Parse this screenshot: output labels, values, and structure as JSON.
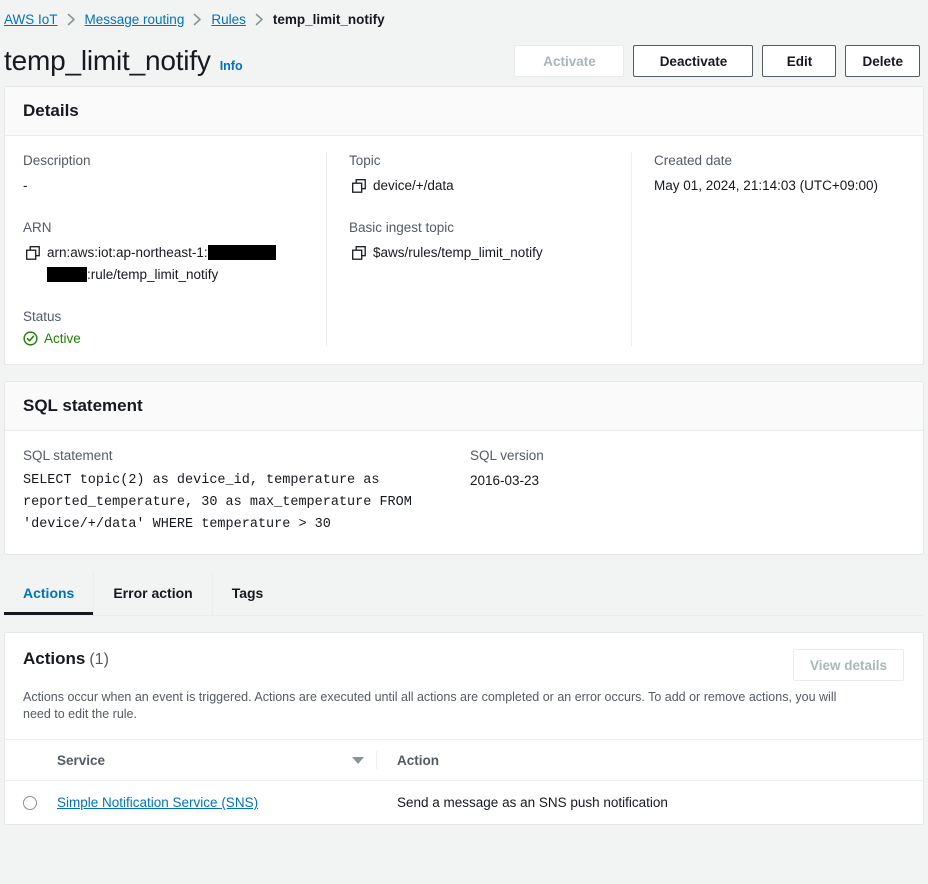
{
  "breadcrumb": {
    "items": [
      {
        "label": "AWS IoT",
        "current": false
      },
      {
        "label": "Message routing",
        "current": false
      },
      {
        "label": "Rules",
        "current": false
      },
      {
        "label": "temp_limit_notify",
        "current": true
      }
    ]
  },
  "header": {
    "title": "temp_limit_notify",
    "info_label": "Info",
    "buttons": [
      {
        "label": "Activate",
        "disabled": true
      },
      {
        "label": "Deactivate",
        "disabled": false
      },
      {
        "label": "Edit",
        "disabled": false
      },
      {
        "label": "Delete",
        "disabled": false
      }
    ]
  },
  "details": {
    "panel_title": "Details",
    "description_label": "Description",
    "description_value": "-",
    "arn_label": "ARN",
    "arn_prefix": "arn:aws:iot:ap-northeast-1:",
    "arn_suffix": ":rule/temp_limit_notify",
    "status_label": "Status",
    "status_value": "Active",
    "status_color": "#1d8102",
    "topic_label": "Topic",
    "topic_value": "device/+/data",
    "basic_ingest_label": "Basic ingest topic",
    "basic_ingest_value": "$aws/rules/temp_limit_notify",
    "created_label": "Created date",
    "created_value": "May 01, 2024, 21:14:03 (UTC+09:00)"
  },
  "sql": {
    "panel_title": "SQL statement",
    "statement_label": "SQL statement",
    "statement_value": "SELECT topic(2) as device_id, temperature as reported_temperature, 30 as max_temperature FROM 'device/+/data' WHERE temperature > 30",
    "version_label": "SQL version",
    "version_value": "2016-03-23"
  },
  "tabs": [
    {
      "label": "Actions",
      "active": true
    },
    {
      "label": "Error action",
      "active": false
    },
    {
      "label": "Tags",
      "active": false
    }
  ],
  "actions": {
    "title": "Actions",
    "count": "(1)",
    "view_details_label": "View details",
    "view_details_disabled": true,
    "description": "Actions occur when an event is triggered. Actions are executed until all actions are completed or an error occurs. To add or remove actions, you will need to edit the rule.",
    "columns": [
      "Service",
      "Action"
    ],
    "rows": [
      {
        "service": "Simple Notification Service (SNS)",
        "action": "Send a message as an SNS push notification"
      }
    ]
  },
  "colors": {
    "link": "#0073bb",
    "text": "#16191f",
    "muted": "#545b64",
    "success": "#1d8102",
    "page_bg": "#f2f3f3"
  }
}
